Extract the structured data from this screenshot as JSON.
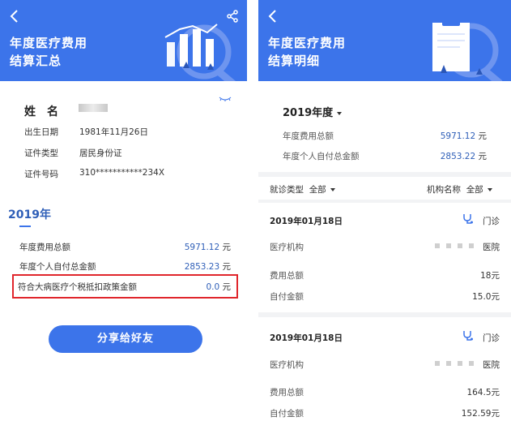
{
  "left": {
    "header_title_line1": "年度医疗费用",
    "header_title_line2": "结算汇总",
    "name_label": "姓　名",
    "profile": [
      {
        "label": "出生日期",
        "value": "1981年11月26日"
      },
      {
        "label": "证件类型",
        "value": "居民身份证"
      },
      {
        "label": "证件号码",
        "value": "310***********234X"
      }
    ],
    "year_title": "2019年",
    "summary": [
      {
        "label": "年度费用总额",
        "value": "5971.12",
        "unit": "元"
      },
      {
        "label": "年度个人自付总金额",
        "value": "2853.23",
        "unit": "元"
      }
    ],
    "highlight": {
      "label": "符合大病医疗个税抵扣政策金额",
      "value": "0.0",
      "unit": "元"
    },
    "share_button": "分享给好友"
  },
  "right": {
    "header_title_line1": "年度医疗费用",
    "header_title_line2": "结算明细",
    "year_select": "2019年度",
    "summary": [
      {
        "label": "年度费用总额",
        "value": "5971.12",
        "unit": "元"
      },
      {
        "label": "年度个人自付总金额",
        "value": "2853.22",
        "unit": "元"
      }
    ],
    "filter_type_label": "就诊类型",
    "filter_type_value": "全部",
    "filter_org_label": "机构名称",
    "filter_org_value": "全部",
    "records": [
      {
        "date": "2019年01月18日",
        "kind": "门诊",
        "org_label": "医疗机构",
        "org_suffix": "医院",
        "fee_label": "费用总额",
        "fee_value": "18元",
        "self_label": "自付金额",
        "self_value": "15.0元"
      },
      {
        "date": "2019年01月18日",
        "kind": "门诊",
        "org_label": "医疗机构",
        "org_suffix": "医院",
        "fee_label": "费用总额",
        "fee_value": "164.5元",
        "self_label": "自付金额",
        "self_value": "152.59元"
      }
    ]
  },
  "colors": {
    "header": "#3c74ea",
    "accent_blue": "#2f5fb8",
    "highlight_border": "#e0262c"
  }
}
